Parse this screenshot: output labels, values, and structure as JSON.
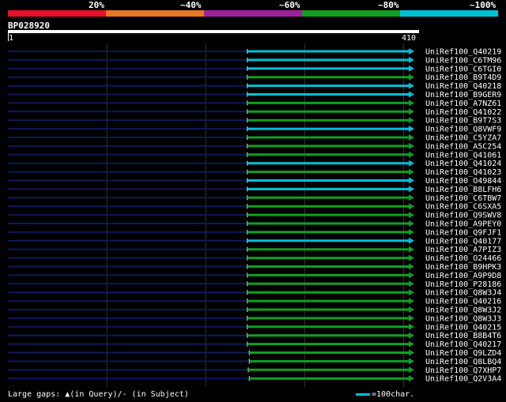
{
  "legend": {
    "colors": [
      "#e8102a",
      "#e87820",
      "#a0209c",
      "#10a020",
      "#00c0d8"
    ],
    "labels": [
      "20%",
      "~40%",
      "~60%",
      "~80%",
      "~100%"
    ]
  },
  "query": {
    "name": "BP028920",
    "start": "1",
    "end": "410",
    "length": 410
  },
  "colors": {
    "query_line": "#0c1a5a",
    "cyan": "#00c0d8",
    "green": "#10a020",
    "grid": "#333333"
  },
  "hits": [
    {
      "name": "UniRef100_Q40219",
      "color": "cyan",
      "start": 242,
      "end": 410
    },
    {
      "name": "UniRef100_C6TM96",
      "color": "cyan",
      "start": 242,
      "end": 410
    },
    {
      "name": "UniRef100_C6TGI0",
      "color": "cyan",
      "start": 242,
      "end": 410
    },
    {
      "name": "UniRef100_B9T4D9",
      "color": "green",
      "start": 242,
      "end": 410
    },
    {
      "name": "UniRef100_Q40218",
      "color": "cyan",
      "start": 242,
      "end": 410
    },
    {
      "name": "UniRef100_B9GER9",
      "color": "cyan",
      "start": 242,
      "end": 410
    },
    {
      "name": "UniRef100_A7NZ61",
      "color": "green",
      "start": 242,
      "end": 410
    },
    {
      "name": "UniRef100_Q41022",
      "color": "green",
      "start": 242,
      "end": 410
    },
    {
      "name": "UniRef100_B9T7S3",
      "color": "green",
      "start": 242,
      "end": 410
    },
    {
      "name": "UniRef100_Q8VWF9",
      "color": "cyan",
      "start": 242,
      "end": 410
    },
    {
      "name": "UniRef100_C5YZA7",
      "color": "green",
      "start": 242,
      "end": 410
    },
    {
      "name": "UniRef100_A5C254",
      "color": "green",
      "start": 242,
      "end": 410
    },
    {
      "name": "UniRef100_Q41061",
      "color": "green",
      "start": 242,
      "end": 410
    },
    {
      "name": "UniRef100_Q41024",
      "color": "cyan",
      "start": 242,
      "end": 410
    },
    {
      "name": "UniRef100_Q41023",
      "color": "green",
      "start": 242,
      "end": 410
    },
    {
      "name": "UniRef100_O49844",
      "color": "cyan",
      "start": 242,
      "end": 410
    },
    {
      "name": "UniRef100_B8LFH6",
      "color": "cyan",
      "start": 242,
      "end": 410
    },
    {
      "name": "UniRef100_C6TBW7",
      "color": "green",
      "start": 242,
      "end": 410
    },
    {
      "name": "UniRef100_C6SXA5",
      "color": "green",
      "start": 242,
      "end": 410
    },
    {
      "name": "UniRef100_Q9SWV8",
      "color": "green",
      "start": 242,
      "end": 410
    },
    {
      "name": "UniRef100_A9PEY0",
      "color": "green",
      "start": 242,
      "end": 410
    },
    {
      "name": "UniRef100_Q9FJF1",
      "color": "green",
      "start": 242,
      "end": 410
    },
    {
      "name": "UniRef100_Q40177",
      "color": "cyan",
      "start": 242,
      "end": 410
    },
    {
      "name": "UniRef100_A7PIZ3",
      "color": "green",
      "start": 242,
      "end": 410
    },
    {
      "name": "UniRef100_O24466",
      "color": "green",
      "start": 242,
      "end": 410
    },
    {
      "name": "UniRef100_B9HPK3",
      "color": "green",
      "start": 242,
      "end": 410
    },
    {
      "name": "UniRef100_A9P9D8",
      "color": "green",
      "start": 242,
      "end": 410
    },
    {
      "name": "UniRef100_P28186",
      "color": "green",
      "start": 242,
      "end": 410
    },
    {
      "name": "UniRef100_Q8W3J4",
      "color": "green",
      "start": 242,
      "end": 410
    },
    {
      "name": "UniRef100_Q40216",
      "color": "green",
      "start": 242,
      "end": 410
    },
    {
      "name": "UniRef100_Q8W3J2",
      "color": "green",
      "start": 242,
      "end": 410
    },
    {
      "name": "UniRef100_Q8W3J3",
      "color": "green",
      "start": 242,
      "end": 410
    },
    {
      "name": "UniRef100_Q40215",
      "color": "green",
      "start": 242,
      "end": 410
    },
    {
      "name": "UniRef100_B8B4T6",
      "color": "green",
      "start": 242,
      "end": 410
    },
    {
      "name": "UniRef100_Q40217",
      "color": "green",
      "start": 242,
      "end": 410
    },
    {
      "name": "UniRef100_Q9LZD4",
      "color": "green",
      "start": 244,
      "end": 410
    },
    {
      "name": "UniRef100_Q8LBQ4",
      "color": "green",
      "start": 244,
      "end": 410
    },
    {
      "name": "UniRef100_Q7XHP7",
      "color": "green",
      "start": 243,
      "end": 410
    },
    {
      "name": "UniRef100_Q2V3A4",
      "color": "green",
      "start": 244,
      "end": 410
    }
  ],
  "footer": {
    "gaps_label": "Large gaps:",
    "gaps_query": "▲(in Query)/",
    "gaps_subject": "- (in Subject)",
    "scale_label": "=100char."
  }
}
